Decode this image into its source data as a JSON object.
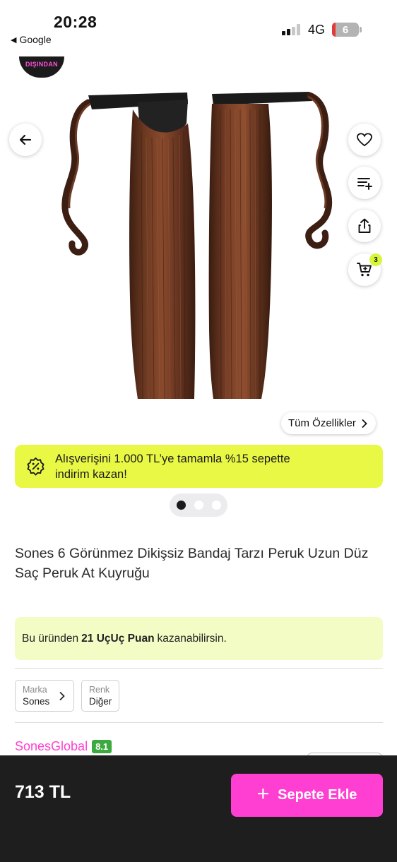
{
  "status": {
    "time": "20:28",
    "back_app": "Google",
    "network": "4G",
    "battery": "6"
  },
  "gallery": {
    "badge": "DIŞINDAN",
    "cart_count": "3",
    "all_features_label": "Tüm Özellikler",
    "dots": {
      "count": 3,
      "active_index": 0
    }
  },
  "promo": {
    "text": "Alışverişini 1.000 TL’ye tamamla %15 sepette indirim kazan!"
  },
  "product": {
    "title": "Sones 6 Görünmez Dikişsiz Bandaj Tarzı Peruk Uzun Düz Saç Peruk At Kuyruğu"
  },
  "points": {
    "prefix": "Bu üründen",
    "amount": "21 UçUç Puan",
    "suffix": "kazanabilirsin."
  },
  "attributes": [
    {
      "label": "Marka",
      "value": "Sones"
    },
    {
      "label": "Renk",
      "value": "Diğer"
    }
  ],
  "seller": {
    "name": "SonesGlobal",
    "rating": "8.1"
  },
  "bottom": {
    "price": "713 TL",
    "add_to_cart": "Sepete Ekle"
  },
  "colors": {
    "accent_pink": "#ff3fd2",
    "promo_yellow": "#e9f845",
    "points_bg": "#f4fcc6",
    "rating_green": "#3daa3f",
    "bottom_bar": "#1e1e1e"
  },
  "icons": [
    "arrow-left-icon",
    "heart-icon",
    "compare-list-icon",
    "share-icon",
    "cart-icon",
    "discount-badge-icon",
    "chevron-right-icon",
    "plus-icon"
  ]
}
